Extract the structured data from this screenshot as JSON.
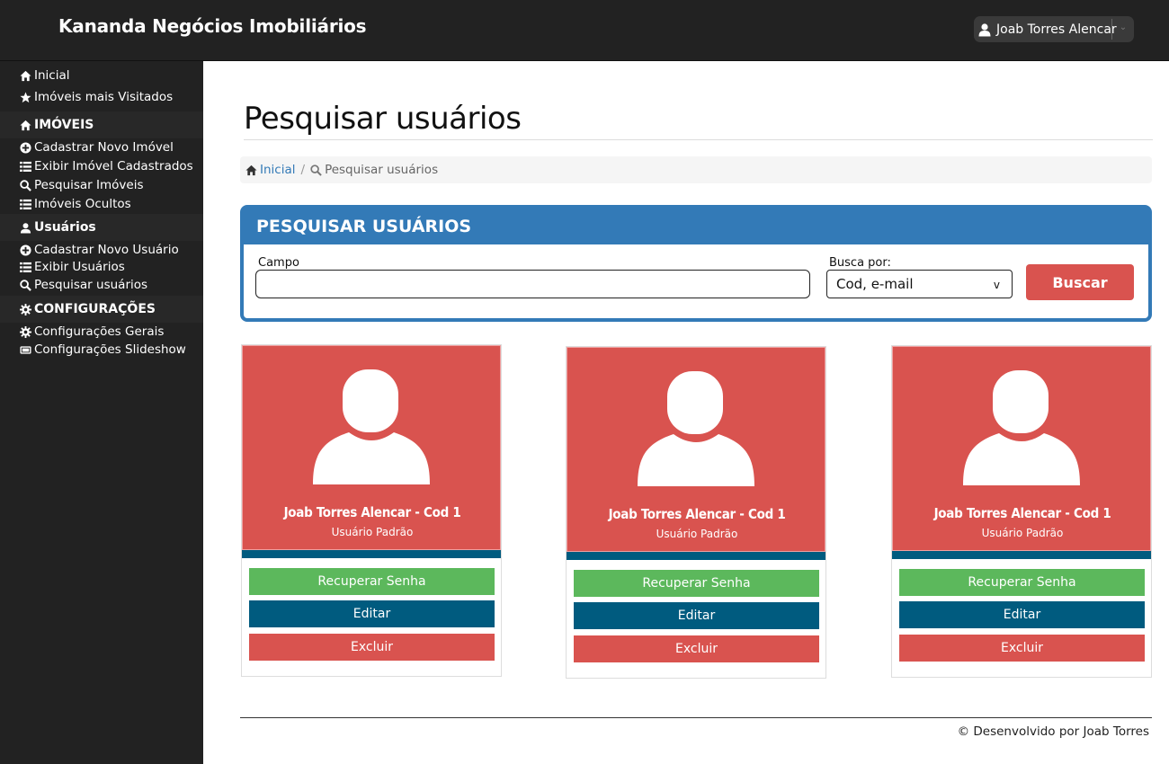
{
  "header": {
    "brand": "Kananda Negócios Imobiliários",
    "user_name": "Joab Torres Alencar"
  },
  "sidebar": {
    "items": [
      {
        "label": "Inicial",
        "icon": "home-icon"
      },
      {
        "label": "Imóveis mais Visitados",
        "icon": "star-icon"
      },
      {
        "label": "IMÓVEIS",
        "icon": "home-icon",
        "heading": true
      },
      {
        "label": "Cadastrar Novo Imóvel",
        "icon": "plus-circle-icon"
      },
      {
        "label": "Exibir Imóvel Cadastrados",
        "icon": "list-icon"
      },
      {
        "label": "Pesquisar Imóveis",
        "icon": "search-icon"
      },
      {
        "label": "Imóveis Ocultos",
        "icon": "list-icon"
      },
      {
        "label": "Usuários",
        "icon": "user-icon",
        "heading": true
      },
      {
        "label": "Cadastrar Novo Usuário",
        "icon": "plus-circle-icon"
      },
      {
        "label": "Exibir Usuários",
        "icon": "list-icon"
      },
      {
        "label": "Pesquisar usuários",
        "icon": "search-icon"
      },
      {
        "label": "CONFIGURAÇÕES",
        "icon": "gear-icon",
        "heading": true
      },
      {
        "label": "Configurações Gerais",
        "icon": "gear-icon"
      },
      {
        "label": "Configurações Slideshow",
        "icon": "slideshow-icon"
      }
    ]
  },
  "main": {
    "title": "Pesquisar usuários",
    "breadcrumb": {
      "home": "Inicial",
      "separator": "/",
      "current": "Pesquisar usuários"
    },
    "search_panel": {
      "title": "PESQUISAR USUÁRIOS",
      "campo_label": "Campo",
      "campo_value": "",
      "busca_label": "Busca por:",
      "busca_selected": "Cod, e-mail",
      "busca_arrow": "v",
      "button": "Buscar"
    },
    "cards": [
      {
        "name": "Joab Torres Alencar - Cod 1",
        "role": "Usuário Padrão",
        "btn_recover": "Recuperar Senha",
        "btn_edit": "Editar",
        "btn_delete": "Excluir"
      },
      {
        "name": "Joab Torres Alencar - Cod 1",
        "role": "Usuário Padrão",
        "btn_recover": "Recuperar Senha",
        "btn_edit": "Editar",
        "btn_delete": "Excluir"
      },
      {
        "name": "Joab Torres Alencar - Cod 1",
        "role": "Usuário Padrão",
        "btn_recover": "Recuperar Senha",
        "btn_edit": "Editar",
        "btn_delete": "Excluir"
      }
    ]
  },
  "footer": {
    "text": "© Desenvolvido por Joab Torres"
  },
  "colors": {
    "dark": "#222222",
    "primary": "#337ab7",
    "danger": "#d9534f",
    "success": "#5cb85c",
    "teal": "#005b7f"
  }
}
